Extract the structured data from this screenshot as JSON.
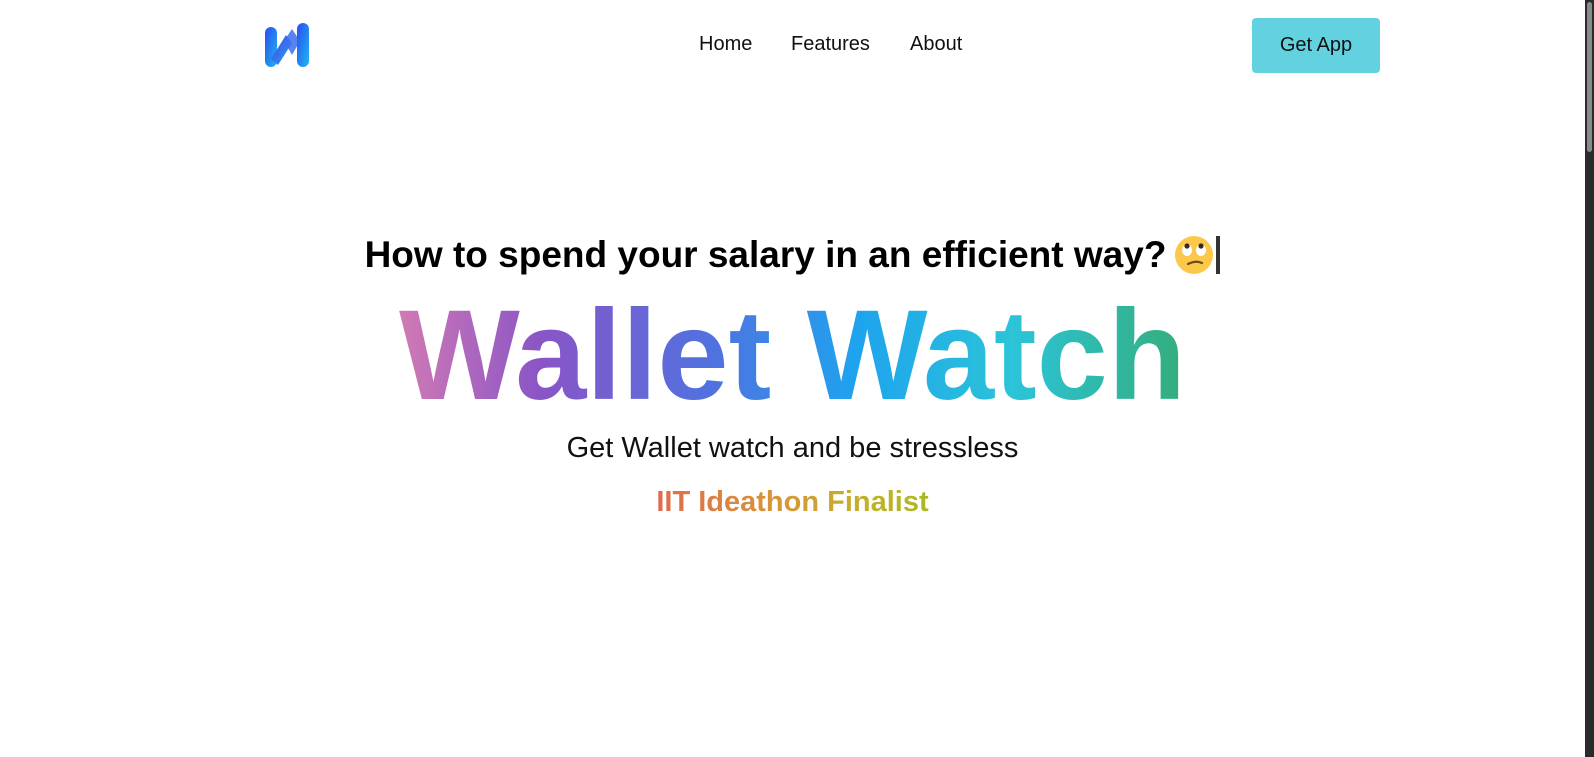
{
  "header": {
    "logo_alt": "Wallet Watch logo",
    "nav": [
      {
        "label": "Home"
      },
      {
        "label": "Features"
      },
      {
        "label": "About"
      }
    ],
    "cta_label": "Get App"
  },
  "hero": {
    "question": "How to spend your salary in an efficient way?",
    "emoji": "rolling-eyes-emoji",
    "title": "Wallet Watch",
    "tagline": "Get Wallet watch and be stressless",
    "award": "IIT Ideathon Finalist"
  },
  "colors": {
    "cta_background": "#63d2e0",
    "title_gradient": [
      "#d17ab4",
      "#8a55c6",
      "#4f72e0",
      "#1ea3ee",
      "#2bc4d8",
      "#35ad7b"
    ],
    "award_gradient": [
      "#e06a4c",
      "#d8923a",
      "#c4b02a",
      "#aab922"
    ]
  }
}
